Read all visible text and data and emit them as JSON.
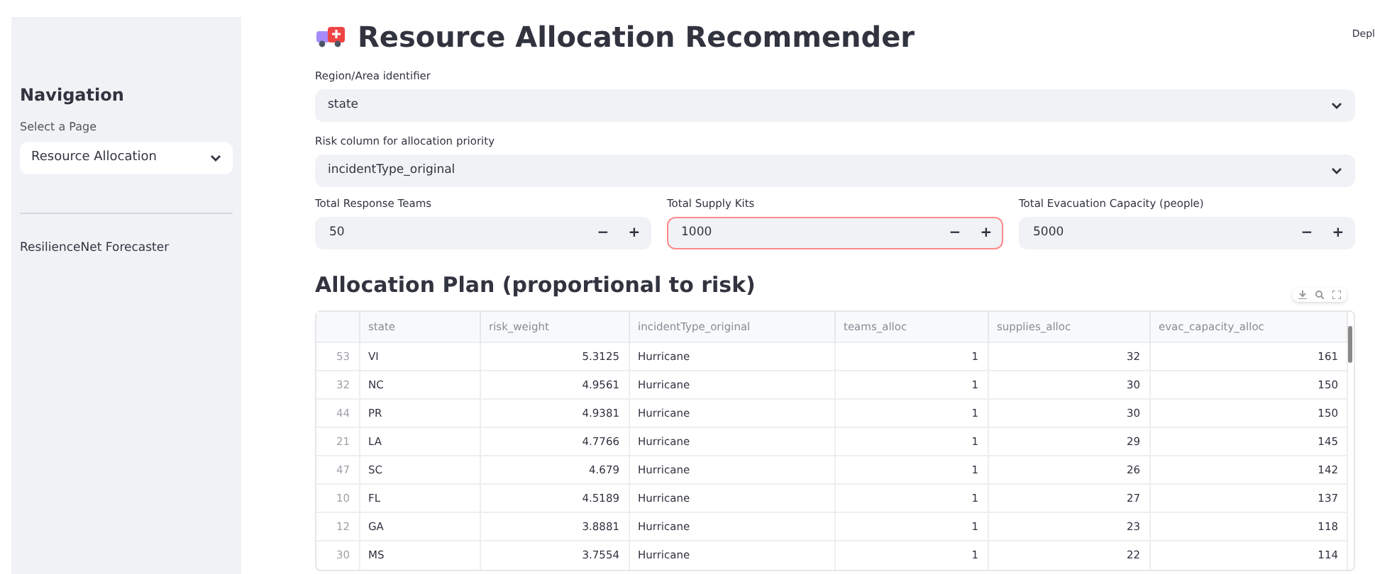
{
  "sidebar": {
    "heading": "Navigation",
    "select_label": "Select a Page",
    "select_value": "Resource Allocation",
    "links": [
      "ResilienceNet Forecaster"
    ]
  },
  "header": {
    "deploy": "Depl"
  },
  "title": "Resource Allocation Recommender",
  "selects": [
    {
      "label": "Region/Area identifier",
      "value": "state"
    },
    {
      "label": "Risk column for allocation priority",
      "value": "incidentType_original"
    }
  ],
  "number_inputs": [
    {
      "label": "Total Response Teams",
      "value": "50",
      "focused": false,
      "minus": "−",
      "plus": "+"
    },
    {
      "label": "Total Supply Kits",
      "value": "1000",
      "focused": true,
      "minus": "−",
      "plus": "+"
    },
    {
      "label": "Total Evacuation Capacity (people)",
      "value": "5000",
      "focused": false,
      "minus": "−",
      "plus": "+"
    }
  ],
  "table_title": "Allocation Plan (proportional to risk)",
  "table": {
    "columns": [
      "",
      "state",
      "risk_weight",
      "incidentType_original",
      "teams_alloc",
      "supplies_alloc",
      "evac_capacity_alloc"
    ],
    "rows": [
      [
        "53",
        "VI",
        "5.3125",
        "Hurricane",
        "1",
        "32",
        "161"
      ],
      [
        "32",
        "NC",
        "4.9561",
        "Hurricane",
        "1",
        "30",
        "150"
      ],
      [
        "44",
        "PR",
        "4.9381",
        "Hurricane",
        "1",
        "30",
        "150"
      ],
      [
        "21",
        "LA",
        "4.7766",
        "Hurricane",
        "1",
        "29",
        "145"
      ],
      [
        "47",
        "SC",
        "4.679",
        "Hurricane",
        "1",
        "26",
        "142"
      ],
      [
        "10",
        "FL",
        "4.5189",
        "Hurricane",
        "1",
        "27",
        "137"
      ],
      [
        "12",
        "GA",
        "3.8881",
        "Hurricane",
        "1",
        "23",
        "118"
      ],
      [
        "30",
        "MS",
        "3.7554",
        "Hurricane",
        "1",
        "22",
        "114"
      ]
    ]
  }
}
